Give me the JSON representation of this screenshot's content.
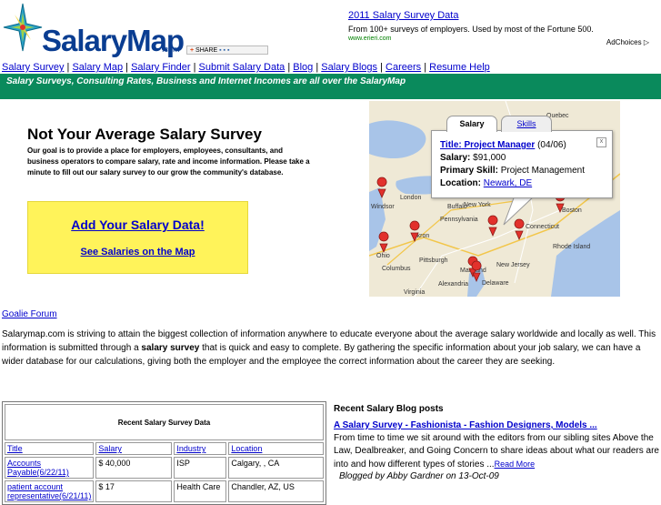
{
  "header": {
    "logo_text": "SalaryMap",
    "logo_suffix": ".com",
    "share_label": "SHARE"
  },
  "ad": {
    "title": "2011 Salary Survey Data",
    "text": "From 100+ surveys of employers. Used by most of the Fortune 500.",
    "url": "www.erieri.com",
    "choices": "AdChoices"
  },
  "nav": {
    "items": [
      "Salary Survey",
      "Salary Map",
      "Salary Finder",
      "Submit Salary Data",
      "Blog",
      "Salary Blogs",
      "Careers",
      "Resume Help"
    ]
  },
  "tagline": "Salary Surveys, Consulting Rates, Business and Internet Incomes are all over the SalaryMap",
  "hero": {
    "title": "Not Your Average Salary Survey",
    "description": "Our goal is to provide a place for employers, employees, consultants, and business operators to compare salary, rate and income information. Please take a minute to fill out our salary survey to our grow the community's database.",
    "cta_primary": "Add Your Salary Data!",
    "cta_secondary": "See Salaries on the Map"
  },
  "map": {
    "tabs": [
      "Salary",
      "Skills"
    ],
    "close": "x",
    "title_label": "Title:",
    "title_value": "Project Manager",
    "title_date": "(04/06)",
    "salary_label": "Salary:",
    "salary_value": "$91,000",
    "skill_label": "Primary Skill:",
    "skill_value": "Project Management",
    "location_label": "Location:",
    "location_value": "Newark, DE",
    "places": [
      "Quebec",
      "London",
      "Windsor",
      "Buffalo",
      "New York",
      "Boston",
      "Akron",
      "Ohio",
      "Columbus",
      "Pittsburgh",
      "Pennsylvania",
      "Connecticut",
      "Rhode Island",
      "New Jersey",
      "Maryland",
      "Delaware",
      "Virginia",
      "Alexandria"
    ]
  },
  "forum_link": "Goalie Forum",
  "intro": {
    "part1": "Salarymap.com is striving to attain the biggest collection of information anywhere to educate everyone about the average salary worldwide and locally as well. This information is submitted through a ",
    "bold": "salary survey",
    "part2": " that is quick and easy to complete. By gathering the specific information about your job salary, we can have a wider database for our calculations, giving both the employer and the employee the correct information about the career they are seeking."
  },
  "survey_table": {
    "caption": "Recent Salary Survey Data",
    "columns": [
      "Title",
      "Salary",
      "Industry",
      "Location"
    ],
    "rows": [
      {
        "title": "Accounts Payable(6/22/11)",
        "salary": "$ 40,000",
        "industry": "ISP",
        "location": "Calgary, , CA"
      },
      {
        "title": "patient account representative(6/21/11)",
        "salary": "$ 17",
        "industry": "Health Care",
        "location": "Chandler, AZ, US"
      }
    ]
  },
  "blog": {
    "heading": "Recent Salary Blog posts",
    "post_title": "A Salary Survey - Fashionista - Fashion Designers, Models ...",
    "excerpt": "From time to time we sit around with the editors from our sibling sites Above the Law, Dealbreaker, and Going Concern to share ideas about what our readers are into and how different types of stories ...",
    "read_more": "Read More",
    "byline": "Blogged by Abby Gardner on 13-Oct-09"
  },
  "colors": {
    "tagline_bg": "#0a8a5c",
    "cta_bg": "#fff35a",
    "link": "#0000cc",
    "brand": "#0a3d91"
  }
}
